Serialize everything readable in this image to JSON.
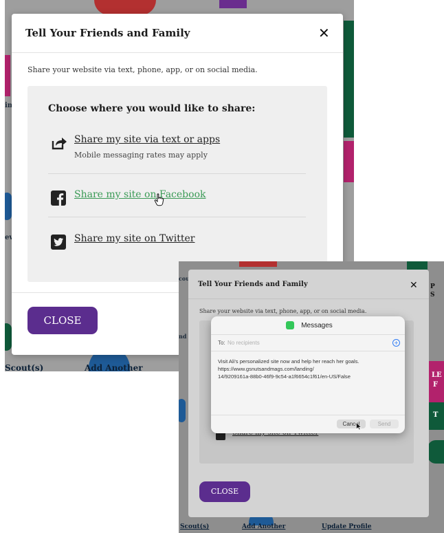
{
  "dialog": {
    "title": "Tell Your Friends and Family",
    "intro": "Share your website via text, phone, app, or on social media.",
    "heading": "Choose where you would like to share:",
    "options": [
      {
        "label": "Share my site via text or apps",
        "sub": "Mobile messaging rates may apply",
        "icon": "share-icon"
      },
      {
        "label": "Share my site on Facebook",
        "icon": "facebook-icon"
      },
      {
        "label": "Share my site on Twitter",
        "icon": "twitter-icon"
      }
    ],
    "close_label": "CLOSE",
    "close_icon": "close-icon"
  },
  "background": {
    "left_texts": [
      "couts",
      "nd",
      "Scout(s)",
      "Add Another",
      "Update Profile",
      "ing C",
      "eval"
    ],
    "right_texts": [
      "P",
      "S",
      "LE",
      "F",
      "T"
    ]
  },
  "messages": {
    "title": "Messages",
    "to_label": "To:",
    "to_placeholder": "No recipients",
    "body_line1": "Visit Ali's personalized site now and help her reach her goals.",
    "body_line2": "https://www.gsnutsandmags.com/landing/",
    "body_line3": "14/9209161a-88b0-46f9-9c54-a1f6654c1f61/en-US/False",
    "cancel_label": "Cancel",
    "send_label": "Send",
    "add_icon": "add-recipient-icon",
    "app_icon": "messages-app-icon"
  },
  "colors": {
    "purple": "#5b2d8e",
    "facebook_link_hover": "#3a9a55",
    "accent_magenta": "#b2226c",
    "accent_green": "#0f5a3a",
    "accent_red": "#c0392b",
    "accent_blue": "#1e5a96"
  }
}
